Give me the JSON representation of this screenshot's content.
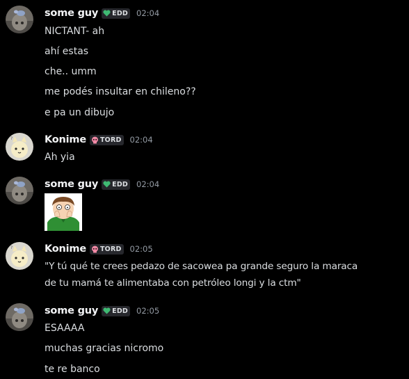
{
  "messages": [
    {
      "author": "some guy",
      "tag": "EDD",
      "time": "02:04",
      "lines": [
        "NICTANT- ah",
        "ahí estas",
        "che.. umm",
        "me podés insultar en chileno??",
        "e pa un dibujo"
      ]
    },
    {
      "author": "Konime",
      "tag": "TORD",
      "time": "02:04",
      "lines": [
        "Ah yia"
      ]
    },
    {
      "author": "some guy",
      "tag": "EDD",
      "time": "02:04",
      "lines": []
    },
    {
      "author": "Konime",
      "tag": "TORD",
      "time": "02:05",
      "lines": [
        "\"Y tú qué te crees pedazo de sacowea pa grande seguro la maraca",
        "de tu mamá te alimentaba con petróleo longi y la ctm\""
      ]
    },
    {
      "author": "some guy",
      "tag": "EDD",
      "time": "02:05",
      "lines": [
        "ESAAAA",
        "muchas gracias nicromo",
        "te re banco"
      ]
    }
  ],
  "icons": {
    "edd_tag": "green-heart-icon",
    "tord_tag": "pink-skull-icon",
    "sticker": "edd-face-sticker"
  },
  "colors": {
    "background": "#000000",
    "username": "#f2f3f5",
    "text": "#dbdee1",
    "timestamp": "#949ba4",
    "edd_icon": "#3fba73",
    "tord_icon": "#f28aa6"
  }
}
